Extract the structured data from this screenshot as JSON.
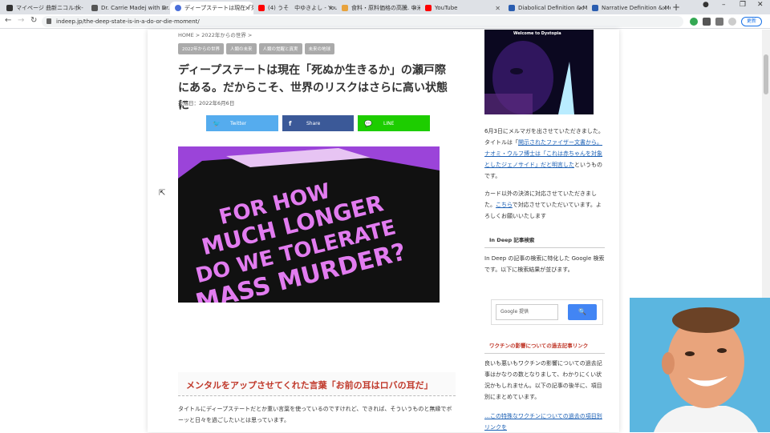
{
  "browser": {
    "tabs": [
      {
        "label": "マイページ 曲新ニコルポ - ニコ",
        "color": "#333333"
      },
      {
        "label": "Dr. Carrie Madej with Dr. A",
        "color": "#555555"
      },
      {
        "label": "ディープステートは現在「死ぬか",
        "color": "#4a6fd9"
      },
      {
        "label": "(4) うそ　中ゆきよし - YouTu",
        "color": "#ff0000"
      },
      {
        "label": "食料・原料価格の高騰. 中米",
        "color": "#e8a33d"
      },
      {
        "label": "YouTube",
        "color": "#ff0000"
      },
      {
        "label": "Diabolical Definition & Me",
        "color": "#2a5db0"
      },
      {
        "label": "Narrative Definition & Me",
        "color": "#2a5db0"
      }
    ],
    "url": "indeep.jp/the-deep-state-is-in-a-do-or-die-moment/",
    "update_label": "更新"
  },
  "article": {
    "breadcrumb": "HOME >  2022年からの世界 >",
    "tags": [
      "2022年からの世界",
      "人類の未来",
      "人類の覚醒と真実",
      "未来の地球"
    ],
    "title": "ディープステートは現在「死ぬか生きるか」の瀬戸際にある。だからこそ、世界のリスクはさらに高い状態に",
    "date": "投稿日：2022年6月6日",
    "share": {
      "twitter": "Twitter",
      "facebook": "Share",
      "line": "LINE"
    },
    "hero_lines": [
      "FOR HOW",
      "MUCH LONGER",
      "DO WE TOLERATE",
      "MASS MURDER?"
    ],
    "section_heading": "メンタルをアップさせてくれた言葉「お前の耳はロバの耳だ」",
    "body": "タイトルにディープステートだとか重い言葉を使っているのですけれど、できれば、そういうものと無縁でボーッと日々を過ごしたいとは思っています。"
  },
  "sidebar": {
    "image_caption": "Welcome to Dystopia",
    "para1_pre": "6月3日にメルマガを出させていただきました。タイトルは「",
    "para1_link": "開示されたファイザー文書から。ナオミ・ウルフ博士は「これは赤ちゃんを対象としたジェノサイド」だと明言した",
    "para1_post": "というものです。",
    "para2_pre": "カード以外の決済に対応させていただきました。",
    "para2_link": "こちら",
    "para2_post": "で対応させていただいています。よろしくお願いいたします",
    "search_heading": "In Deep 記事検索",
    "search_desc": "In Deep の記事の検索に特化した Google 検索です。以下に検索結果が並びます。",
    "search_placeholder": "Google 提供",
    "search_button": "🔍",
    "vaccine_heading": "ワクチンの影響についての過去記事リンク",
    "vaccine_desc": "良いも悪いもワクチンの影響についての過去記事はかなりの数となりまして、わかりにくい状況かもしれません。以下の記事の後半に、項目別にまとめています。",
    "vaccine_link": "…この特殊なワクチンについての過去の項目別リンクを"
  }
}
